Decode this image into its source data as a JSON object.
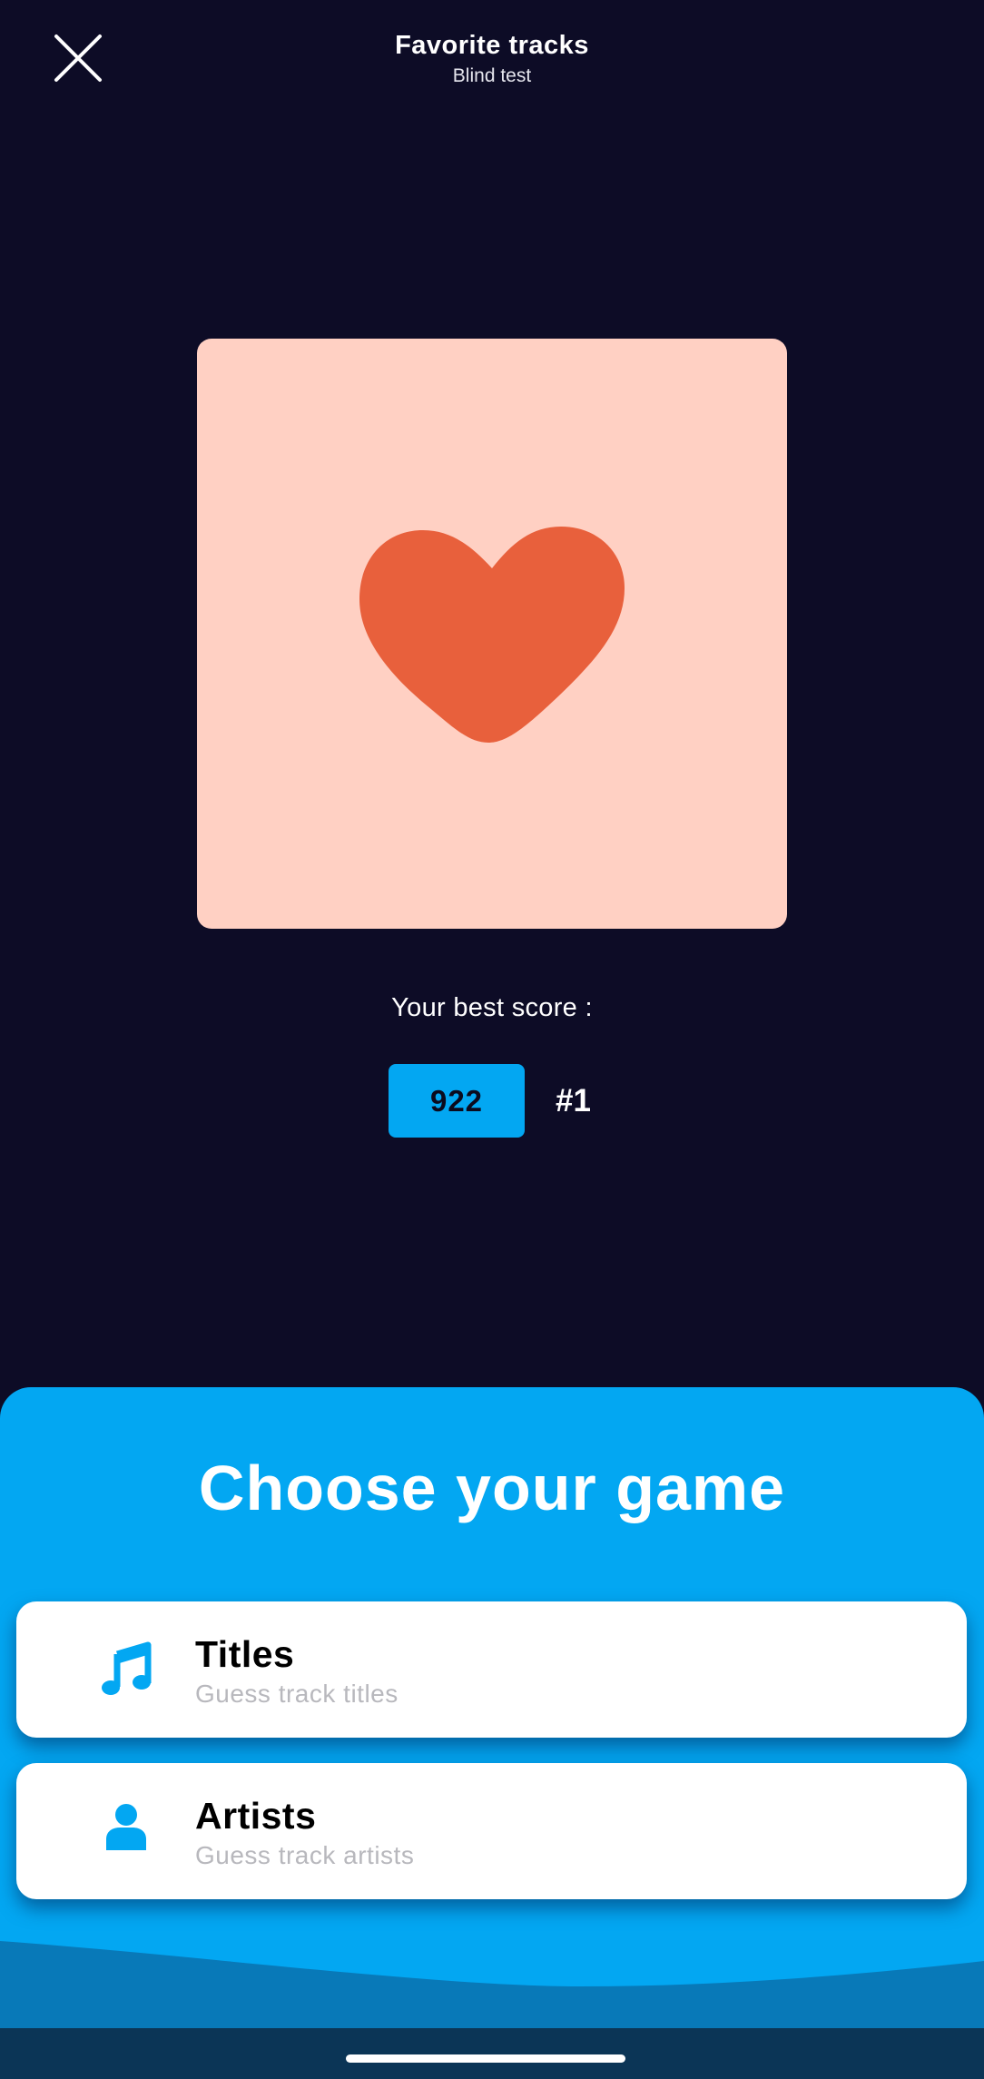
{
  "header": {
    "title": "Favorite tracks",
    "subtitle": "Blind test",
    "close_icon": "close-icon"
  },
  "cover": {
    "background_color": "#ffd0c3",
    "icon": "heart-icon",
    "icon_color": "#e8603c"
  },
  "score": {
    "label": "Your best score :",
    "value": "922",
    "rank": "#1"
  },
  "game_picker": {
    "title": "Choose your game",
    "options": [
      {
        "label": "Titles",
        "description": "Guess track titles",
        "icon": "music-note-icon"
      },
      {
        "label": "Artists",
        "description": "Guess track artists",
        "icon": "person-icon"
      }
    ]
  },
  "colors": {
    "background": "#0d0c26",
    "accent": "#03a7f2",
    "wave": "#0879b8",
    "navbar": "#0b3556"
  }
}
